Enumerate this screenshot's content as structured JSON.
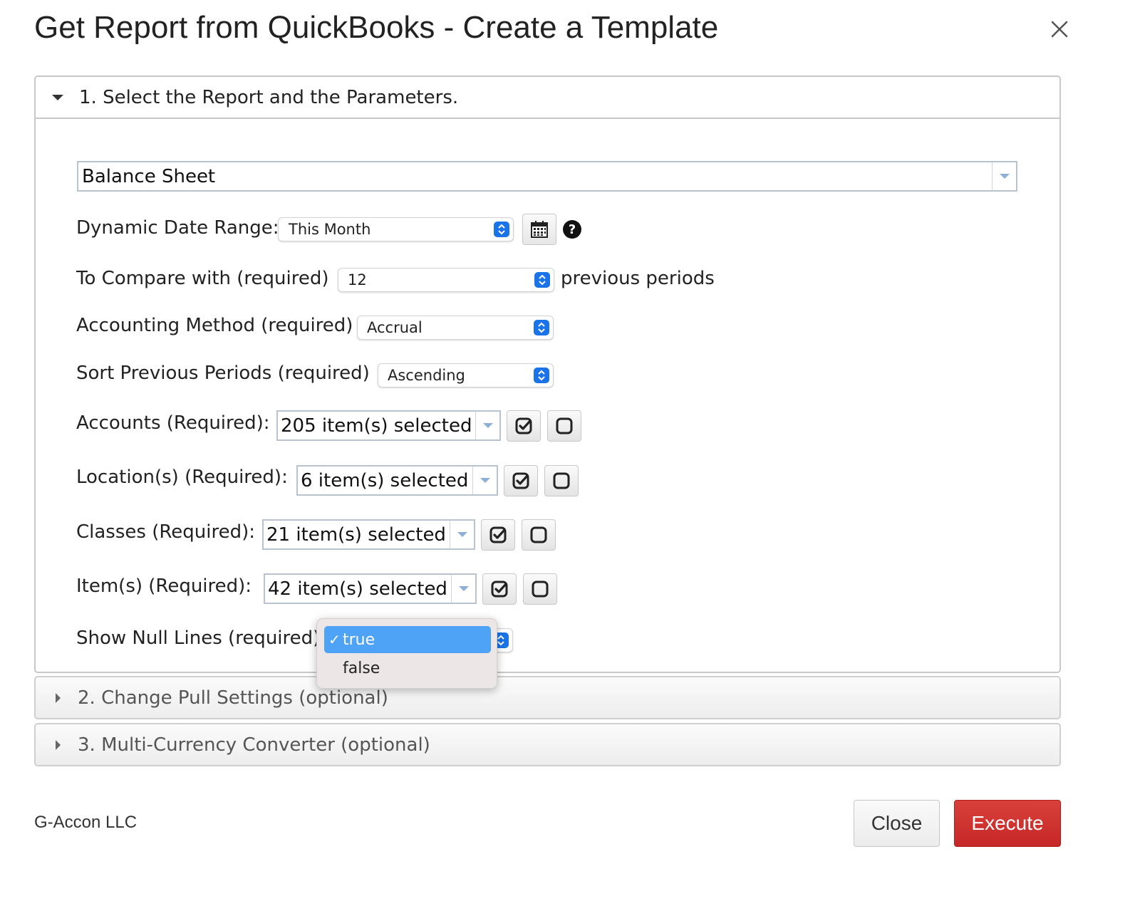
{
  "dialog": {
    "title": "Get Report from QuickBooks - Create a Template"
  },
  "sections": {
    "s1": {
      "label": "1. Select the Report and the Parameters.",
      "expanded": true
    },
    "s2": {
      "label": "2. Change Pull Settings (optional)",
      "expanded": false
    },
    "s3": {
      "label": "3. Multi-Currency Converter (optional)",
      "expanded": false
    }
  },
  "report": {
    "selected": "Balance Sheet"
  },
  "fields": {
    "date_range": {
      "label": "Dynamic Date Range:",
      "value": "This Month"
    },
    "compare": {
      "label": "To Compare with (required)",
      "value": "12",
      "suffix": "previous periods"
    },
    "accounting": {
      "label": "Accounting Method (required)",
      "value": "Accrual"
    },
    "sort": {
      "label": "Sort Previous Periods (required)",
      "value": "Ascending"
    },
    "accounts": {
      "label": "Accounts (Required):",
      "value": "205 item(s) selected"
    },
    "locations": {
      "label": "Location(s) (Required):",
      "value": "6 item(s) selected"
    },
    "classes": {
      "label": "Classes (Required):",
      "value": "21 item(s) selected"
    },
    "items": {
      "label": "Item(s) (Required):",
      "value": "42 item(s) selected"
    },
    "null_lines": {
      "label": "Show Null Lines (required)",
      "value": "true",
      "options": [
        {
          "label": "true",
          "selected": true
        },
        {
          "label": "false",
          "selected": false
        }
      ]
    }
  },
  "icons": {
    "calendar": "calendar-icon",
    "help": "question-circle-icon",
    "check_all": "check-square-icon",
    "uncheck_all": "empty-square-icon",
    "close": "close-icon"
  },
  "footer": {
    "company": "G-Accon LLC",
    "close_label": "Close",
    "execute_label": "Execute"
  },
  "colors": {
    "execute": "#c62828",
    "selection": "#4fa3f7",
    "select_arrows": "#1a73e8"
  }
}
